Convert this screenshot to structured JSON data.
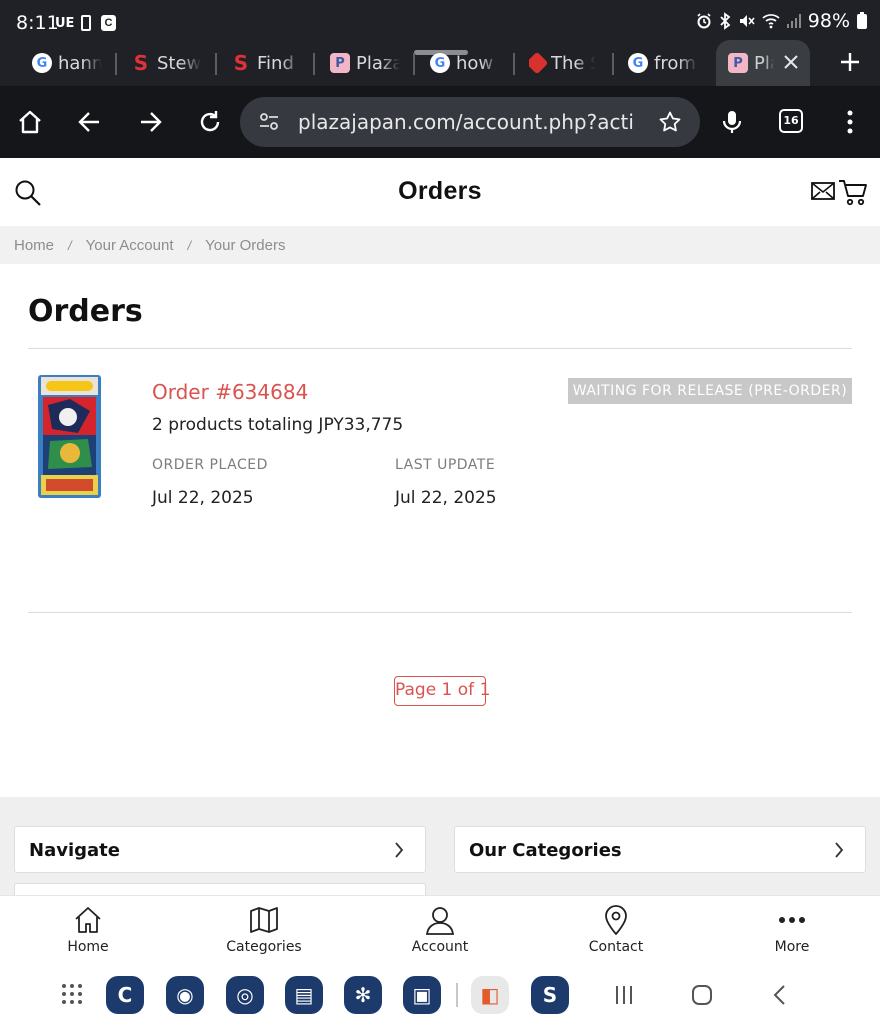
{
  "status_bar": {
    "time": "8:11",
    "indicator": "UE",
    "battery": "98%",
    "icons": [
      "alarm-icon",
      "bluetooth-icon",
      "mute-icon",
      "wifi-icon",
      "signal-icon",
      "battery-icon"
    ]
  },
  "browser": {
    "tabs": [
      {
        "title": "hanna",
        "favicon": "google-icon"
      },
      {
        "title": "Stew",
        "favicon": "s-logo-icon"
      },
      {
        "title": "Find",
        "favicon": "s-logo-icon"
      },
      {
        "title": "Plaza",
        "favicon": "plaza-icon"
      },
      {
        "title": "how t",
        "favicon": "google-icon"
      },
      {
        "title": "The S",
        "favicon": "the-s-icon"
      },
      {
        "title": "from",
        "favicon": "google-icon"
      },
      {
        "title": "Pla",
        "favicon": "plaza-icon",
        "active": true
      }
    ],
    "url": "plazajapan.com/account.php?action=",
    "tab_count": "16"
  },
  "site": {
    "header_title": "Orders"
  },
  "breadcrumb": [
    "Home",
    "Your Account",
    "Your Orders"
  ],
  "page": {
    "heading": "Orders",
    "order": {
      "number": "Order #634684",
      "summary": "2 products totaling JPY33,775",
      "status": "WAITING FOR RELEASE (PRE-ORDER)",
      "placed_label": "ORDER PLACED",
      "placed_value": "Jul 22, 2025",
      "update_label": "LAST UPDATE",
      "update_value": "Jul 22, 2025"
    },
    "pagination": "Page 1 of 1"
  },
  "footer": {
    "navigate": "Navigate",
    "categories": "Our Categories"
  },
  "bottom_nav": [
    {
      "label": "Home",
      "icon": "home-icon"
    },
    {
      "label": "Categories",
      "icon": "map-icon"
    },
    {
      "label": "Account",
      "icon": "user-icon"
    },
    {
      "label": "Contact",
      "icon": "location-pin-icon"
    },
    {
      "label": "More",
      "icon": "more-dots-icon"
    }
  ],
  "colors": {
    "accent": "#d9534f",
    "badge": "#c8c8c8",
    "browser_bg": "#1f2126"
  }
}
